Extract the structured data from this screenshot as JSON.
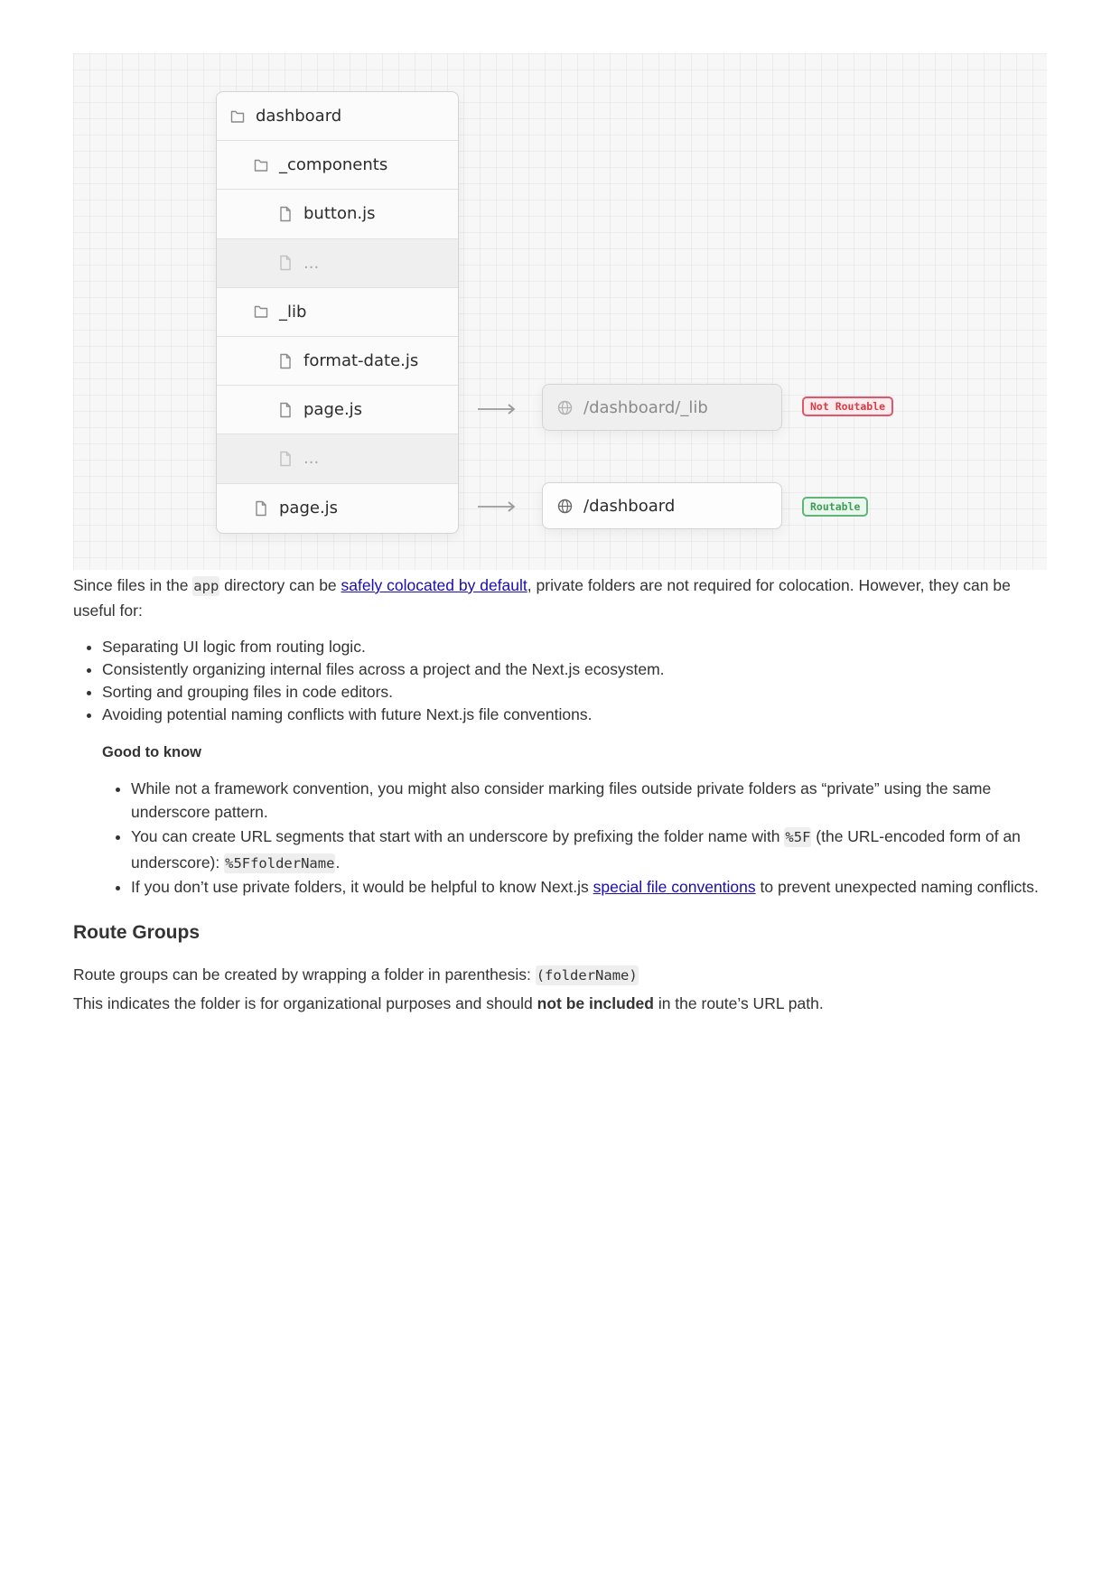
{
  "diagram": {
    "tree": [
      {
        "label": "dashboard",
        "kind": "folder",
        "level": 0,
        "dim": false
      },
      {
        "label": "_components",
        "kind": "folder",
        "level": 1,
        "dim": false
      },
      {
        "label": "button.js",
        "kind": "file",
        "level": 2,
        "dim": false
      },
      {
        "label": "...",
        "kind": "file",
        "level": 2,
        "dim": true
      },
      {
        "label": "_lib",
        "kind": "folder",
        "level": 1,
        "dim": false
      },
      {
        "label": "format-date.js",
        "kind": "file",
        "level": 2,
        "dim": false
      },
      {
        "label": "page.js",
        "kind": "file",
        "level": 2,
        "dim": false
      },
      {
        "label": "...",
        "kind": "file",
        "level": 2,
        "dim": true
      },
      {
        "label": "page.js",
        "kind": "file",
        "level": 1,
        "dim": false
      }
    ],
    "routes": [
      {
        "url": "/dashboard/_lib",
        "badge": "Not Routable",
        "status": "not-routable"
      },
      {
        "url": "/dashboard",
        "badge": "Routable",
        "status": "routable"
      }
    ],
    "colors": {
      "not_routable": "#e0566a",
      "routable": "#62b57a"
    }
  },
  "intro": {
    "t1": "Since files in the ",
    "code1": "app",
    "t2": " directory can be ",
    "link": "safely colocated by default",
    "t3": ", private folders are not required for colocation. However, they can be useful for:"
  },
  "uses": [
    "Separating UI logic from routing logic.",
    "Consistently organizing internal files across a project and the Next.js ecosystem.",
    "Sorting and grouping files in code editors.",
    "Avoiding potential naming conflicts with future Next.js file conventions."
  ],
  "note": {
    "title": "Good to know",
    "item1": "While not a framework convention, you might also consider marking files outside private folders as “private” using the same underscore pattern.",
    "item2": {
      "t1": "You can create URL segments that start with an underscore by prefixing the folder name with ",
      "code1": "%5F",
      "t2": " (the URL-encoded form of an underscore): ",
      "code2": "%5FfolderName",
      "t3": "."
    },
    "item3": {
      "t1": "If you don’t use private folders, it would be helpful to know Next.js ",
      "link": "special file conventions",
      "t2": " to prevent unexpected naming conflicts."
    }
  },
  "route_groups": {
    "heading": "Route Groups",
    "p1_text": "Route groups can be created by wrapping a folder in parenthesis: ",
    "p1_code": "(folderName)",
    "p2_t1": "This indicates the folder is for organizational purposes and should ",
    "p2_bold": "not be included",
    "p2_t2": " in the route’s URL path."
  }
}
